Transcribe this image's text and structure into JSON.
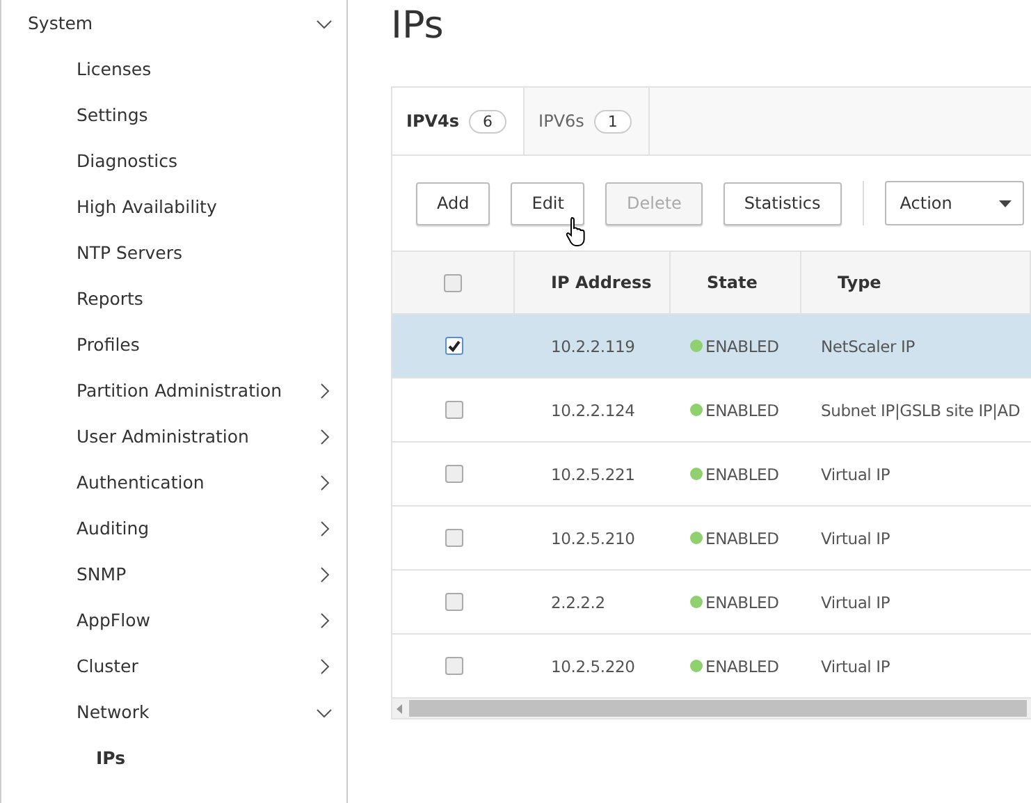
{
  "sidebar": {
    "items": [
      {
        "label": "System",
        "expanded": true,
        "children": [
          {
            "label": "Licenses",
            "selected": false
          },
          {
            "label": "Settings",
            "selected": false
          },
          {
            "label": "Diagnostics",
            "selected": false
          },
          {
            "label": "High Availability",
            "selected": false
          },
          {
            "label": "NTP Servers",
            "selected": false
          },
          {
            "label": "Reports",
            "selected": false
          },
          {
            "label": "Profiles",
            "selected": false
          },
          {
            "label": "Partition Administration",
            "selected": false,
            "expanded": false
          },
          {
            "label": "User Administration",
            "selected": false,
            "expanded": false
          },
          {
            "label": "Authentication",
            "selected": false,
            "expanded": false
          },
          {
            "label": "Auditing",
            "selected": false,
            "expanded": false
          },
          {
            "label": "SNMP",
            "selected": false,
            "expanded": false
          },
          {
            "label": "AppFlow",
            "selected": false,
            "expanded": false
          },
          {
            "label": "Cluster",
            "selected": false,
            "expanded": false
          },
          {
            "label": "Network",
            "selected": false,
            "expanded": true,
            "children": [
              {
                "label": "IPs",
                "selected": true
              }
            ]
          }
        ]
      }
    ]
  },
  "page": {
    "title": "IPs"
  },
  "tabs": [
    {
      "label": "IPV4s",
      "count": "6",
      "selected": true
    },
    {
      "label": "IPV6s",
      "count": "1",
      "selected": false
    }
  ],
  "toolbar": {
    "buttons": [
      {
        "label": "Add",
        "disabled": false
      },
      {
        "label": "Edit",
        "disabled": false
      },
      {
        "label": "Delete",
        "disabled": true
      },
      {
        "label": "Statistics",
        "disabled": false
      }
    ],
    "action": {
      "label": "Action"
    }
  },
  "table": {
    "columns": [
      "IP Address",
      "State",
      "Type"
    ],
    "all_checked": false,
    "rows": [
      {
        "ip": "10.2.2.119",
        "state": "ENABLED",
        "type": "NetScaler IP",
        "selected": true,
        "checked": true
      },
      {
        "ip": "10.2.2.124",
        "state": "ENABLED",
        "type": "Subnet IP|GSLB site IP|AD",
        "selected": false,
        "checked": false
      },
      {
        "ip": "10.2.5.221",
        "state": "ENABLED",
        "type": "Virtual IP",
        "selected": false,
        "checked": false
      },
      {
        "ip": "10.2.5.210",
        "state": "ENABLED",
        "type": "Virtual IP",
        "selected": false,
        "checked": false
      },
      {
        "ip": "2.2.2.2",
        "state": "ENABLED",
        "type": "Virtual IP",
        "selected": false,
        "checked": false
      },
      {
        "ip": "10.2.5.220",
        "state": "ENABLED",
        "type": "Virtual IP",
        "selected": false,
        "checked": false
      }
    ]
  }
}
